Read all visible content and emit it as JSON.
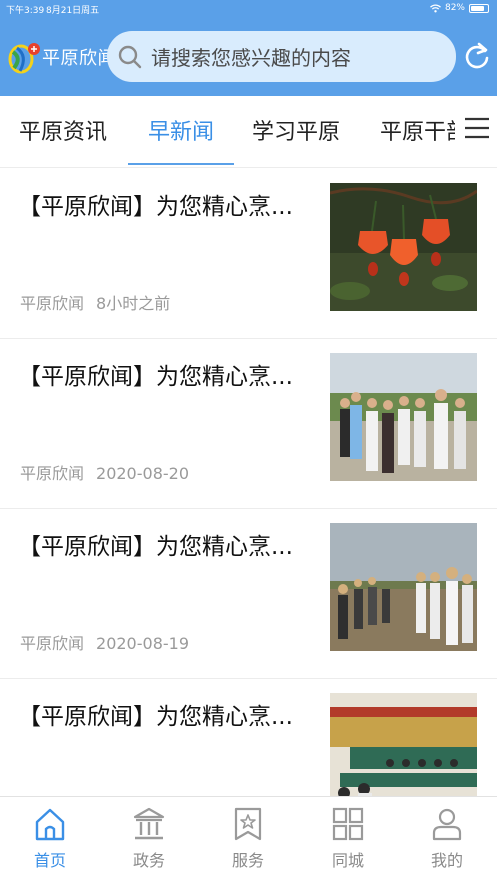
{
  "status": {
    "time": "下午3:39",
    "date": "8月21日周五",
    "battery": "82%",
    "battery_level": 0.82
  },
  "header": {
    "brand": "平原欣闻",
    "search_placeholder": "请搜索您感兴趣的内容"
  },
  "tabs": [
    {
      "label": "平原资讯"
    },
    {
      "label": "早新闻"
    },
    {
      "label": "学习平原"
    },
    {
      "label": "平原干部"
    }
  ],
  "news": [
    {
      "title": "【平原欣闻】为您精心烹...",
      "source": "平原欣闻",
      "time": "8小时之前"
    },
    {
      "title": "【平原欣闻】为您精心烹...",
      "source": "平原欣闻",
      "time": "2020-08-20"
    },
    {
      "title": "【平原欣闻】为您精心烹...",
      "source": "平原欣闻",
      "time": "2020-08-19"
    },
    {
      "title": "【平原欣闻】为您精心烹...",
      "source": "",
      "time": ""
    }
  ],
  "bottom_nav": [
    {
      "label": "首页",
      "icon": "home-icon"
    },
    {
      "label": "政务",
      "icon": "government-icon"
    },
    {
      "label": "服务",
      "icon": "service-icon"
    },
    {
      "label": "同城",
      "icon": "city-grid-icon"
    },
    {
      "label": "我的",
      "icon": "user-icon"
    }
  ],
  "colors": {
    "header": "#5aa0e8",
    "accent": "#3a8fe6",
    "search_bg": "#d9ecfd"
  }
}
